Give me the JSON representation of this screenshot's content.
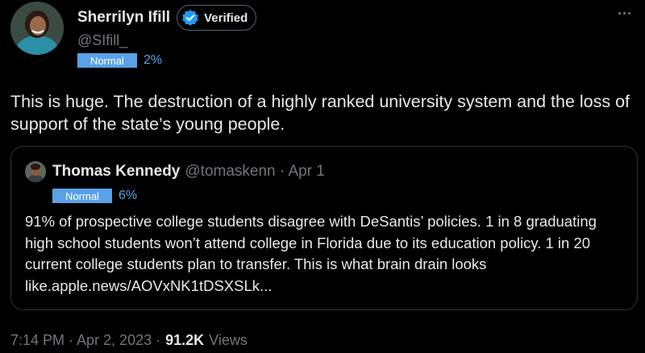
{
  "author": {
    "display_name": "Sherrilyn Ifill",
    "verified_label": "Verified",
    "handle": "@SIfill_",
    "label_badge": "Normal",
    "label_pct": "2%"
  },
  "tweet": {
    "text": "This is huge. The destruction of a highly ranked university system and the loss of support of the state’s young people."
  },
  "quote": {
    "display_name": "Thomas Kennedy",
    "handle_date": "@tomaskenn · Apr 1",
    "label_badge": "Normal",
    "label_pct": "6%",
    "text": "91% of prospective college students disagree with DeSantis’ policies. 1 in 8 graduating high school students won’t attend college in Florida due to its education policy. 1 in 20 current college students plan to transfer. This is what brain drain looks like.apple.news/AOVxNK1tDSXSLk..."
  },
  "footer": {
    "time_date": "7:14 PM · Apr 2, 2023 ·",
    "views_count": "91.2K",
    "views_label": "Views"
  },
  "icons": {
    "verified": "verified-badge-icon",
    "more": "more-options-icon"
  },
  "colors": {
    "background": "#000000",
    "text": "#e7e9ea",
    "muted": "#71767b",
    "label_blue": "#5aa1e8",
    "verified_blue": "#1d9bf0",
    "border": "#2f3336"
  }
}
